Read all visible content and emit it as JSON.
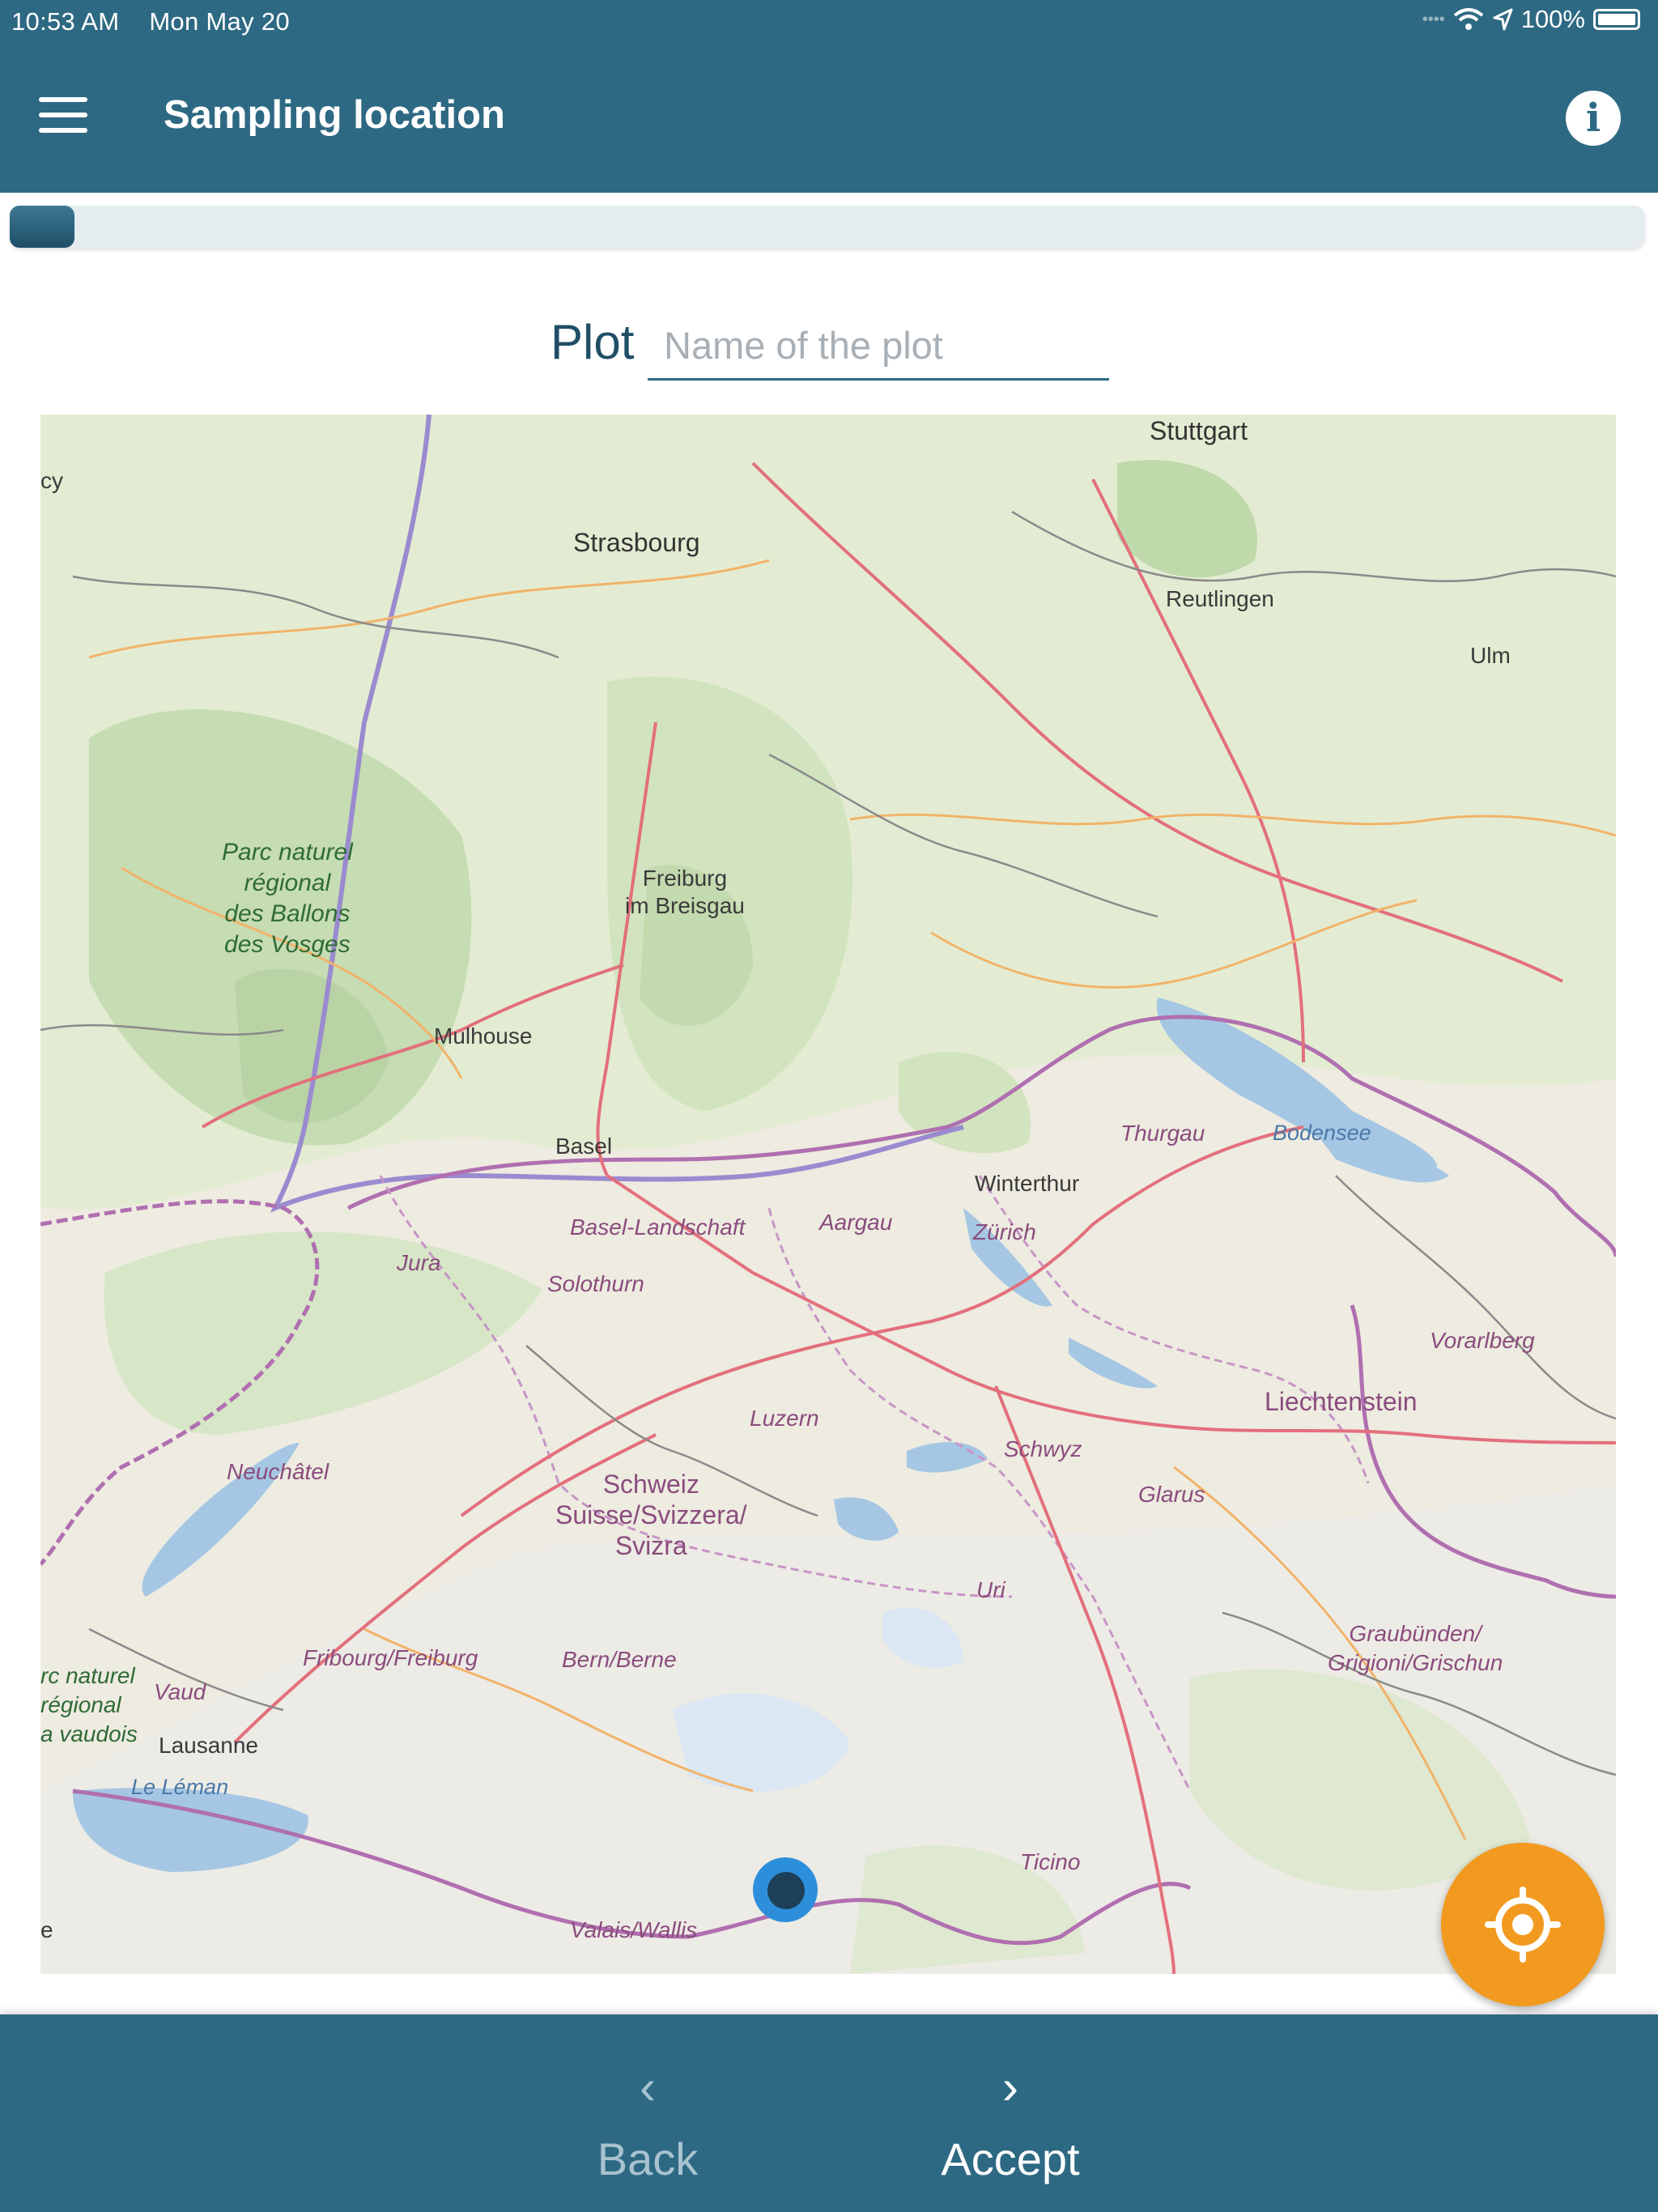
{
  "status_bar": {
    "time": "10:53 AM",
    "date": "Mon May 20",
    "battery": "100%"
  },
  "header": {
    "title": "Sampling location",
    "menu_icon": "hamburger-menu-icon",
    "info_icon": "info-icon",
    "info_glyph": "i"
  },
  "progress": {
    "fraction": 0.02
  },
  "plot": {
    "label": "Plot",
    "placeholder": "Name of the plot",
    "value": ""
  },
  "map": {
    "labels": {
      "stuttgart": "Stuttgart",
      "strasbourg": "Strasbourg",
      "reutlingen": "Reutlingen",
      "ulm": "Ulm",
      "cy": "cy",
      "park_vosges": [
        "Parc naturel",
        "régional",
        "des Ballons",
        "des Vosges"
      ],
      "freiburg": [
        "Freiburg",
        "im Breisgau"
      ],
      "mulhouse": "Mulhouse",
      "basel": "Basel",
      "thurgau": "Thurgau",
      "bodensee": "Bodensee",
      "winterthur": "Winterthur",
      "basel_landschaft": "Basel-Landschaft",
      "aargau": "Aargau",
      "zurich": "Zürich",
      "jura": "Jura",
      "solothurn": "Solothurn",
      "vorarlberg": "Vorarlberg",
      "liechtenstein": "Liechtenstein",
      "luzern": "Luzern",
      "schwyz": "Schwyz",
      "neuchatel": "Neuchâtel",
      "switzerland": [
        "Schweiz",
        "Suisse/Svizzera/",
        "Svizra"
      ],
      "glarus": "Glarus",
      "uri": "Uri",
      "graubunden": [
        "Graubünden/",
        "Grigioni/Grischun"
      ],
      "fribourg": "Fribourg/Freiburg",
      "bern": "Bern/Berne",
      "park_vaudois": [
        "rc naturel",
        "régional",
        "a vaudois"
      ],
      "vaud": "Vaud",
      "lausanne": "Lausanne",
      "leman": "Le Léman",
      "ticino": "Ticino",
      "valais": "Valais/Wallis",
      "e_edge": "e"
    }
  },
  "locate_button": {
    "icon": "crosshair-locate-icon"
  },
  "nav": {
    "back_label": "Back",
    "back_icon": "‹",
    "accept_label": "Accept",
    "accept_icon": "›"
  },
  "colors": {
    "primary": "#2e6983",
    "accent": "#f29a1f",
    "pin": "#2d8fdc"
  }
}
